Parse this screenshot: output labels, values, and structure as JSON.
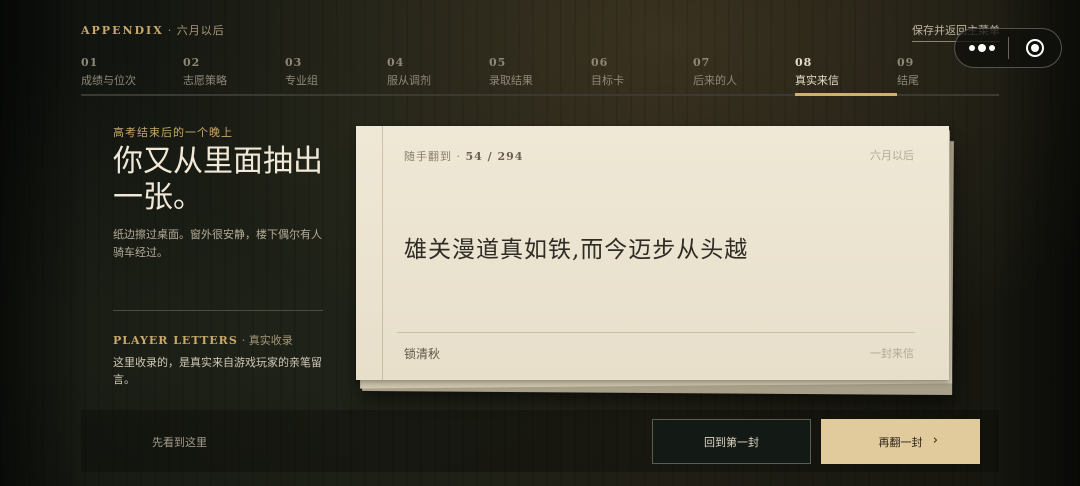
{
  "header": {
    "title": "APPENDIX",
    "subtitle": "· 六月以后",
    "save_link": "保存并返回主菜单"
  },
  "steps": [
    {
      "num": "01",
      "label": "成绩与位次"
    },
    {
      "num": "02",
      "label": "志愿策略"
    },
    {
      "num": "03",
      "label": "专业组"
    },
    {
      "num": "04",
      "label": "服从调剂"
    },
    {
      "num": "05",
      "label": "录取结果"
    },
    {
      "num": "06",
      "label": "目标卡"
    },
    {
      "num": "07",
      "label": "后来的人"
    },
    {
      "num": "08",
      "label": "真实来信",
      "active": true
    },
    {
      "num": "09",
      "label": "结尾"
    }
  ],
  "left": {
    "eyebrow": "高考结束后的一个晚上",
    "headline": "你又从里面抽出一张。",
    "description": "纸边擦过桌面。窗外很安静，楼下偶尔有人骑车经过。",
    "player_letters_title": "PLAYER LETTERS",
    "player_letters_sub": "· 真实收录",
    "player_letters_desc": "这里收录的，是真实来自游戏玩家的亲笔留言。"
  },
  "card": {
    "meta_label": "随手翻到 ·",
    "meta_count": "54 / 294",
    "date": "六月以后",
    "quote": "雄关漫道真如铁,而今迈步从头越",
    "author": "锁清秋",
    "type": "一封来信"
  },
  "bottom": {
    "note": "先看到这里",
    "first_button": "回到第一封",
    "next_button": "再翻一封",
    "next_chevron": "›"
  },
  "capsule": {
    "menu_icon": "more-dots-icon",
    "close_icon": "target-close-icon"
  },
  "colors": {
    "accent": "#c9a86a",
    "active_underline": "#d2ae72",
    "card_bg": "#efe8d6",
    "next_button_bg": "#e1cb9c"
  }
}
